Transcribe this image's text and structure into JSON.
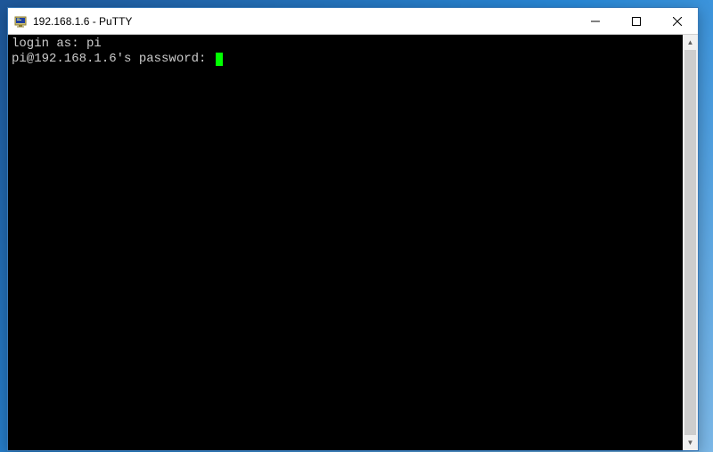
{
  "window": {
    "title": "192.168.1.6 - PuTTY"
  },
  "terminal": {
    "login_prompt": "login as: ",
    "login_value": "pi",
    "password_prompt": "pi@192.168.1.6's password: "
  },
  "colors": {
    "cursor": "#00ff00",
    "terminal_bg": "#000000",
    "terminal_fg": "#cccccc"
  }
}
